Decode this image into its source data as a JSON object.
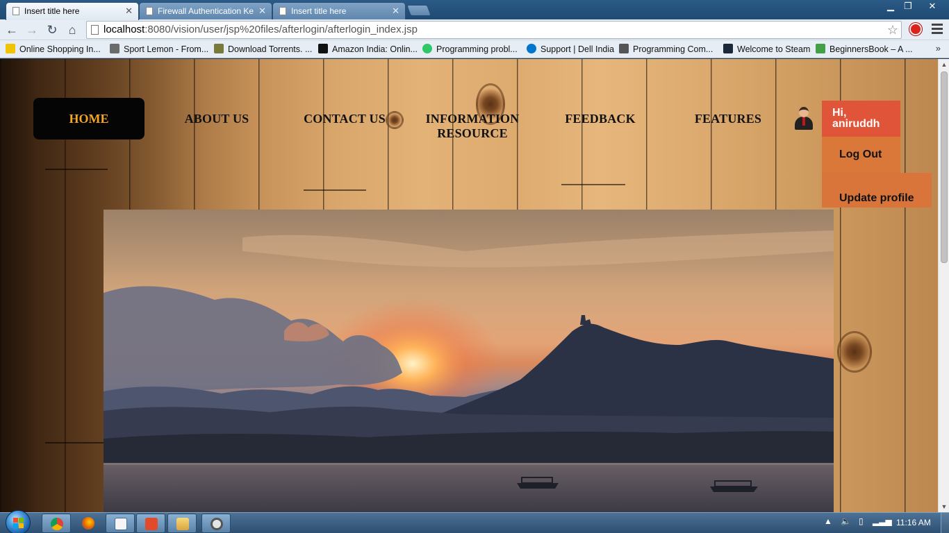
{
  "browser": {
    "tabs": [
      {
        "title": "Insert title here",
        "active": true
      },
      {
        "title": "Firewall Authentication Ke",
        "active": false
      },
      {
        "title": "Insert title here",
        "active": false
      }
    ],
    "window_controls": {
      "minimize": "▁",
      "maximize": "❐",
      "close": "✕"
    },
    "nav": {
      "back": "←",
      "forward": "→",
      "reload": "↻",
      "home": "⌂"
    },
    "address": {
      "host": "localhost",
      "rest": ":8080/vision/user/jsp%20files/afterlogin/afterlogin_index.jsp"
    },
    "bookmarks": [
      {
        "label": "Online Shopping In...",
        "color": "#f2c300"
      },
      {
        "label": "Sport Lemon - From...",
        "color": "#6b6b6b"
      },
      {
        "label": "Download Torrents. ...",
        "color": "#7a7a3a"
      },
      {
        "label": "Amazon India: Onlin...",
        "color": "#111111"
      },
      {
        "label": "Programming probl...",
        "color": "#2ec866"
      },
      {
        "label": "Support | Dell India",
        "color": "#0076ce"
      },
      {
        "label": "Programming Com...",
        "color": "#555555"
      },
      {
        "label": "Welcome to Steam",
        "color": "#1b2838"
      },
      {
        "label": "BeginnersBook – A ...",
        "color": "#43a047"
      }
    ],
    "bookmarks_more": "»"
  },
  "site": {
    "nav": {
      "home": "HOME",
      "about": "ABOUT US",
      "contact": "CONTACT US",
      "info_line1": "INFORMATION",
      "info_line2": "RESOURCE",
      "feedback": "FEEDBACK",
      "features": "FEATURES"
    },
    "user": {
      "greeting_line1": "Hi,",
      "greeting_line2": "aniruddh",
      "logout": "Log Out",
      "update_profile": "Update profile"
    },
    "colors": {
      "home_text": "#f5a623",
      "user_head_bg": "#e0553a",
      "menu_item_bg": "#d9743a"
    }
  },
  "taskbar": {
    "apps": [
      "chrome-icon",
      "firefox-icon",
      "wordpad-icon",
      "foxit-icon",
      "explorer-icon",
      "settings-icon"
    ],
    "clock": "11:16 AM"
  }
}
